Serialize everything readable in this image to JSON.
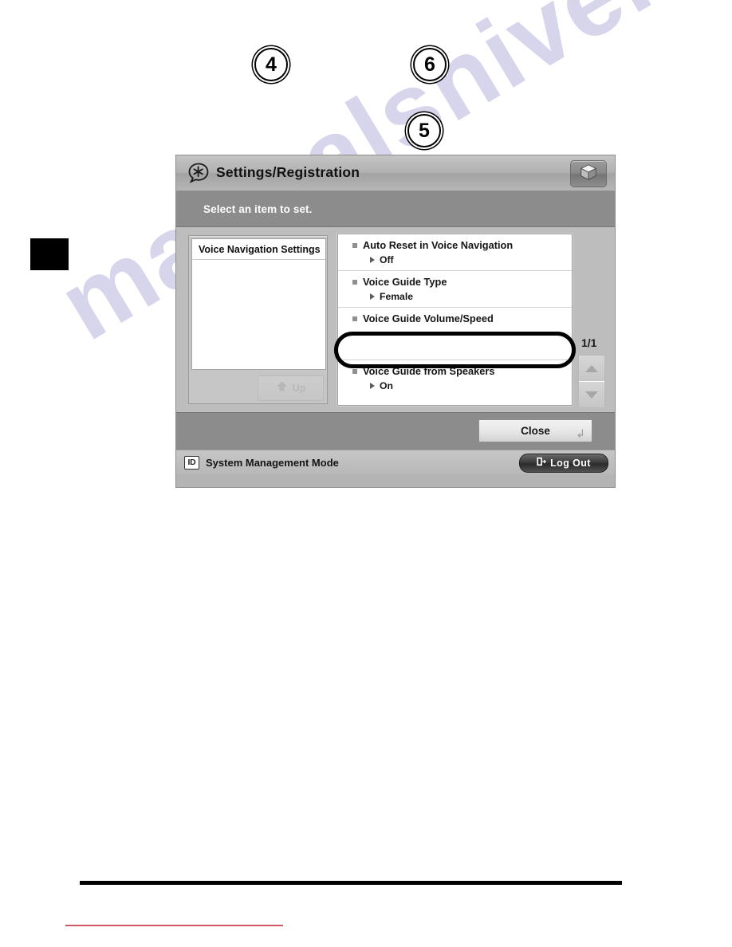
{
  "page": {
    "steps": [
      {
        "id": "step-4",
        "number": "4"
      },
      {
        "id": "step-6",
        "number": "6"
      },
      {
        "id": "step-5",
        "number": "5"
      }
    ],
    "watermark": "manualshive.com"
  },
  "screen": {
    "titlebar": {
      "title": "Settings/Registration",
      "icon": "settings-asterisk-icon",
      "right_button_icon": "cube-icon"
    },
    "instruction": "Select an item to set.",
    "left_panel": {
      "header": "Voice Navigation Settings",
      "up_button": {
        "label": "Up",
        "icon": "arrow-up-icon",
        "disabled": true
      }
    },
    "settings_list": [
      {
        "title": "Auto Reset in Voice Navigation",
        "value": "Off",
        "selected": false
      },
      {
        "title": "Voice Guide Type",
        "value": "Female",
        "selected": false
      },
      {
        "title": "Voice Guide Volume/Speed",
        "value": "",
        "selected": false
      },
      {
        "title": "Voice Guide from Speakers",
        "value": "On",
        "selected": true
      }
    ],
    "pager": {
      "label": "1/1",
      "scroll_up_icon": "triangle-up-icon",
      "scroll_down_icon": "triangle-down-icon"
    },
    "close_button": {
      "label": "Close",
      "enter_glyph": "↲"
    },
    "statusbar": {
      "id_badge": "ID",
      "mode_text": "System Management Mode",
      "logout_label": "Log Out",
      "logout_icon": "exit-door-icon"
    }
  },
  "colors": {
    "screen_bg": "#bdbdbd",
    "titlebar": "#b2b2b2",
    "instruction_bar": "#8c8c8c",
    "highlight_ring": "#000000",
    "watermark": "#c9c8e6",
    "rule_red": "#cf5866"
  }
}
